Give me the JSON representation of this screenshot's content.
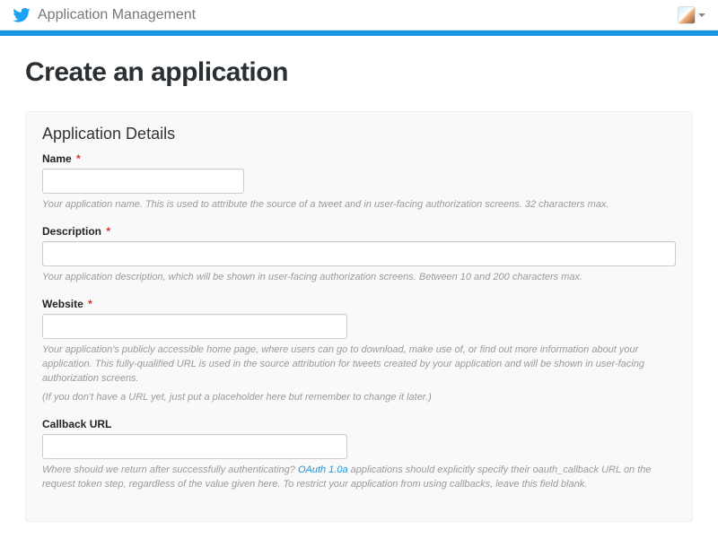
{
  "header": {
    "title": "Application Management"
  },
  "page": {
    "title": "Create an application"
  },
  "panel": {
    "title": "Application Details",
    "fields": {
      "name": {
        "label": "Name",
        "required_marker": "*",
        "value": "",
        "help": "Your application name. This is used to attribute the source of a tweet and in user-facing authorization screens. 32 characters max."
      },
      "description": {
        "label": "Description",
        "required_marker": "*",
        "value": "",
        "help": "Your application description, which will be shown in user-facing authorization screens. Between 10 and 200 characters max."
      },
      "website": {
        "label": "Website",
        "required_marker": "*",
        "value": "",
        "help": "Your application's publicly accessible home page, where users can go to download, make use of, or find out more information about your application. This fully-qualified URL is used in the source attribution for tweets created by your application and will be shown in user-facing authorization screens.",
        "help_extra": "(If you don't have a URL yet, just put a placeholder here but remember to change it later.)"
      },
      "callback": {
        "label": "Callback URL",
        "value": "",
        "help_pre": "Where should we return after successfully authenticating? ",
        "help_link": "OAuth 1.0a",
        "help_post": " applications should explicitly specify their oauth_callback URL on the request token step, regardless of the value given here. To restrict your application from using callbacks, leave this field blank."
      }
    }
  }
}
